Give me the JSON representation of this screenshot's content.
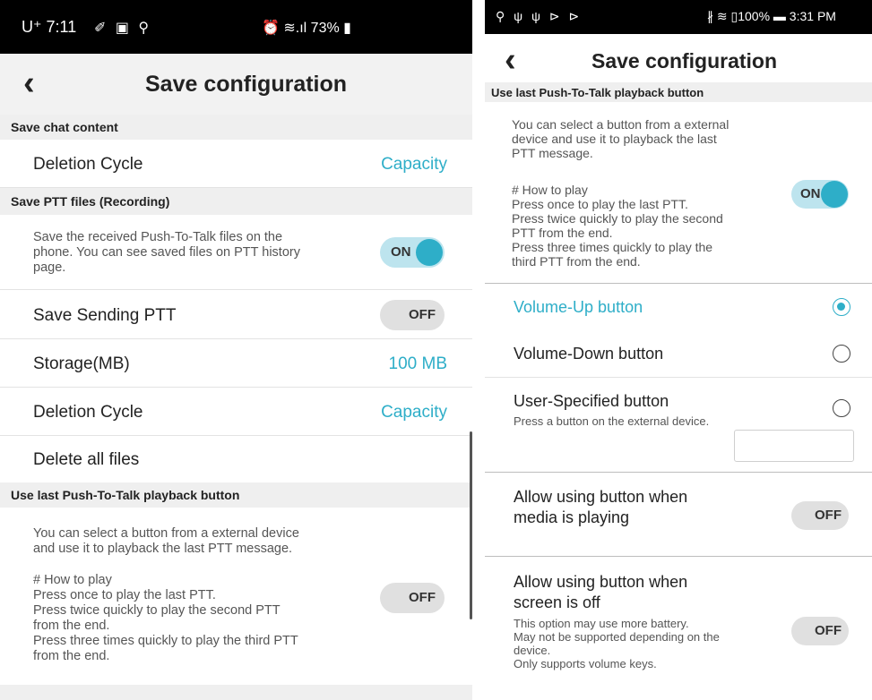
{
  "left": {
    "status": {
      "time": "U⁺ 7:11",
      "icons": "✐ ▣ ⚲",
      "right": "⏰ ≋.ıl 73% ▮"
    },
    "title": "Save configuration",
    "save_chat": {
      "header": "Save chat content",
      "deletion_label": "Deletion Cycle",
      "deletion_value": "Capacity"
    },
    "save_ptt": {
      "header": "Save PTT files (Recording)",
      "desc": "Save the received Push-To-Talk files on the\nphone. You can see saved files on PTT history\npage.",
      "toggle": "ON",
      "sending_label": "Save Sending PTT",
      "sending_toggle": "OFF",
      "storage_label": "Storage(MB)",
      "storage_value": "100 MB",
      "deletion_label": "Deletion Cycle",
      "deletion_value": "Capacity",
      "delete_all": "Delete all files"
    },
    "playback": {
      "header": "Use last Push-To-Talk playback button",
      "desc": "You can select a button from a external device\nand use it to playback the last PTT message.",
      "how": "# How to play\nPress once to play the last PTT.\nPress twice quickly to play the second PTT\nfrom the end.\nPress three times quickly to play the third PTT\nfrom the end.",
      "toggle": "OFF"
    }
  },
  "right": {
    "status": {
      "icons": "⚲ ψ ψ ⊳ ⊳",
      "right": "∦ ≋ ▯100% ▬ 3:31 PM"
    },
    "title": "Save configuration",
    "header": "Use last Push-To-Talk playback button",
    "desc": "You can select a button from a external\ndevice and use it to playback the last\nPTT message.",
    "how": "# How to play\nPress once to play the last PTT.\nPress twice quickly to play the second\nPTT from the end.\nPress three times quickly to play the\nthird PTT from the end.",
    "toggle": "ON",
    "vol_up": "Volume-Up button",
    "vol_down": "Volume-Down button",
    "user_spec": "User-Specified button",
    "user_spec_desc": "Press a button on the external device.",
    "media": "Allow using button when\nmedia is playing",
    "media_toggle": "OFF",
    "screen_off": "Allow using button when\nscreen is off",
    "screen_off_desc": "This option may use more battery.\nMay not be supported depending on the\ndevice.\nOnly supports volume keys.",
    "screen_off_toggle": "OFF"
  },
  "colors": {
    "accent": "#2eaec8",
    "header_bg": "#efefef",
    "toggle_off": "#e0e0e0"
  }
}
